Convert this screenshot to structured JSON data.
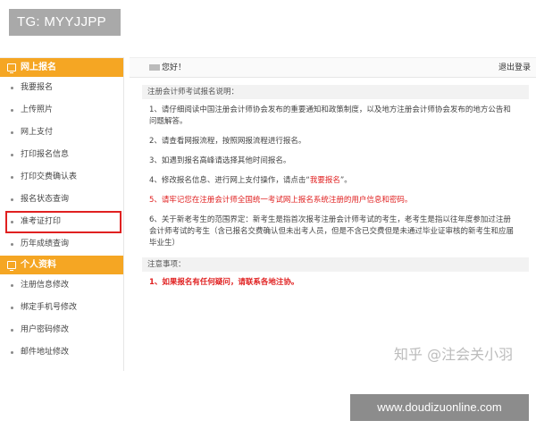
{
  "tag_badge": "TG: MYYJJPP",
  "sidebar": {
    "section1": {
      "title": "网上报名",
      "items": [
        {
          "label": "我要报名"
        },
        {
          "label": "上传照片"
        },
        {
          "label": "网上支付"
        },
        {
          "label": "打印报名信息"
        },
        {
          "label": "打印交费确认表"
        },
        {
          "label": "报名状态查询"
        },
        {
          "label": "准考证打印"
        },
        {
          "label": "历年成绩查询"
        }
      ]
    },
    "section2": {
      "title": "个人资料",
      "items": [
        {
          "label": "注册信息修改"
        },
        {
          "label": "绑定手机号修改"
        },
        {
          "label": "用户密码修改"
        },
        {
          "label": "邮件地址修改"
        }
      ]
    }
  },
  "topbar": {
    "greeting": "您好！",
    "logout": "退出登录"
  },
  "notice_section": {
    "title": "注册会计师考试报名说明：",
    "items": [
      {
        "text": "1、请仔细阅读中国注册会计师协会发布的重要通知和政策制度，以及地方注册会计师协会发布的地方公告和问题解答。"
      },
      {
        "text": "2、请查看网报流程，按照网报流程进行报名。"
      },
      {
        "text": "3、如遇到报名高峰请选择其他时间报名。"
      },
      {
        "text_before": "4、修改报名信息、进行网上支付操作，请点击“",
        "link": "我要报名",
        "text_after": "”。"
      },
      {
        "text": "5、请牢记您在注册会计师全国统一考试网上报名系统注册的用户信息和密码。"
      },
      {
        "text_head": "6、关于新老考生的范围界定：",
        "text": "新考生是指首次报考注册会计师考试的考生，老考生是指以往年度参加过注册会计师考试的考生（含已报名交费确认但未出考人员，但是不含已交费但是未通过毕业证审核的新考生和应届毕业生）"
      }
    ]
  },
  "attention_section": {
    "title": "注意事项：",
    "items": [
      {
        "text": "1、如果报名有任何疑问，请联系各地注协。"
      }
    ]
  },
  "watermark": "知乎 @注会关小羽",
  "site_badge": "www.doudizuonline.com",
  "colors": {
    "accent": "#f5a623",
    "highlight_border": "#e02020",
    "badge_gray": "#a9a9a9"
  }
}
